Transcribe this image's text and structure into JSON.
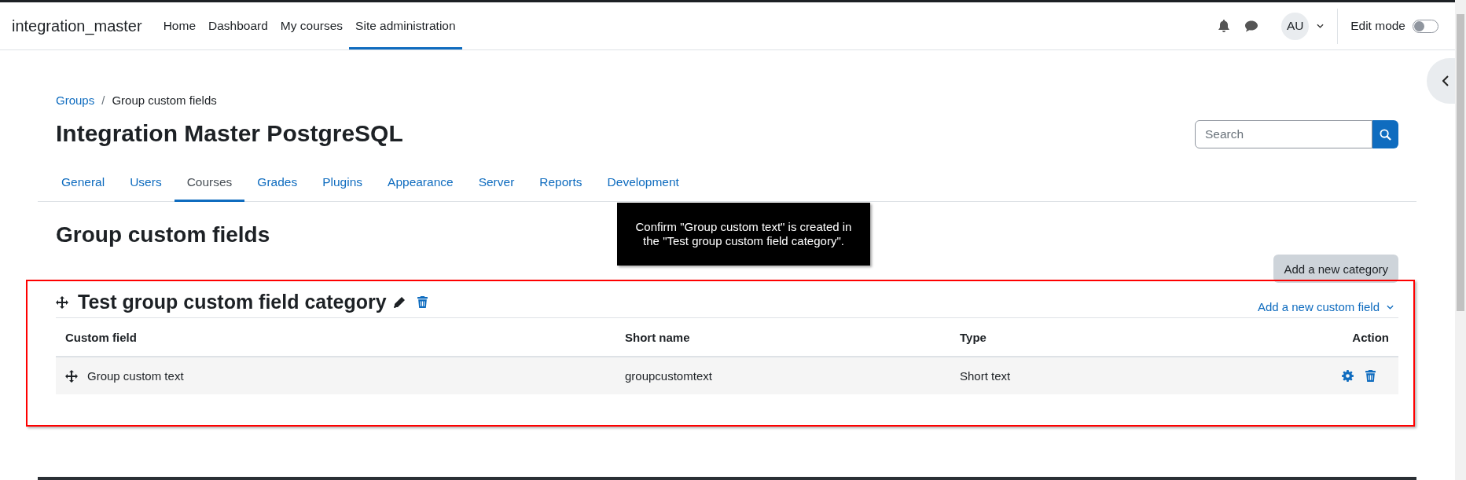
{
  "site_name": "integration_master",
  "nav": [
    {
      "label": "Home",
      "selected": false
    },
    {
      "label": "Dashboard",
      "selected": false
    },
    {
      "label": "My courses",
      "selected": false
    },
    {
      "label": "Site administration",
      "selected": true
    }
  ],
  "user": {
    "initials": "AU"
  },
  "edit_mode": {
    "label": "Edit mode",
    "on": false
  },
  "breadcrumb_separator": "/",
  "breadcrumb": [
    {
      "label": "Groups",
      "link": true
    },
    {
      "label": "Group custom fields",
      "link": false
    }
  ],
  "page_title": "Integration Master PostgreSQL",
  "search": {
    "placeholder": "Search"
  },
  "admin_tabs": [
    {
      "label": "General",
      "selected": false
    },
    {
      "label": "Users",
      "selected": false
    },
    {
      "label": "Courses",
      "selected": true
    },
    {
      "label": "Grades",
      "selected": false
    },
    {
      "label": "Plugins",
      "selected": false
    },
    {
      "label": "Appearance",
      "selected": false
    },
    {
      "label": "Server",
      "selected": false
    },
    {
      "label": "Reports",
      "selected": false
    },
    {
      "label": "Development",
      "selected": false
    }
  ],
  "heading": "Group custom fields",
  "tooltip": "Confirm \"Group custom text\" is created in the \"Test group custom field category\".",
  "add_category_button": "Add a new category",
  "category": {
    "name": "Test group custom field category",
    "add_field_link": "Add a new custom field",
    "columns": [
      "Custom field",
      "Short name",
      "Type",
      "Action"
    ],
    "rows": [
      {
        "name": "Group custom text",
        "shortname": "groupcustomtext",
        "type": "Short text"
      }
    ]
  }
}
